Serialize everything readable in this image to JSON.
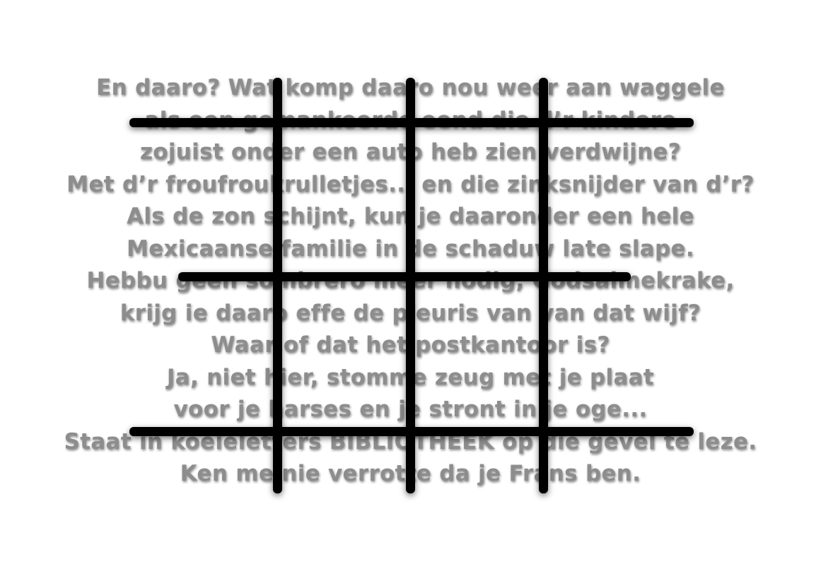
{
  "poem": {
    "lines": [
      "En daaro? Wat komp daaro nou weer aan waggele",
      "als een gemankeerde eend die d’r kindere",
      "zojuist onder een auto heb zien verdwijne?",
      "Met d’r froufroukrulletjes... en die zinksnijder van d’r?",
      "Als de zon schijnt, kun je daaronder een hele",
      "Mexicaanse familie in de schaduw late slape.",
      "Hebbu geen sombrero meer nodig, Godsalmekrake,",
      "krijg ie daaro effe de pleuris van van dat wijf?",
      "Waar of dat het postkantoor is?",
      "Ja, niet hier, stomme zeug met je plaat",
      "voor je harses en je stront in je oge...",
      "Staat in koeieletters BIBLIOTHEEK op die gevel te leze.",
      "Ken me nie verrotte da je Frans ben."
    ]
  },
  "colors": {
    "background": "#ffffff",
    "text": "#8d8d8d",
    "grid_bars": "#000000"
  }
}
